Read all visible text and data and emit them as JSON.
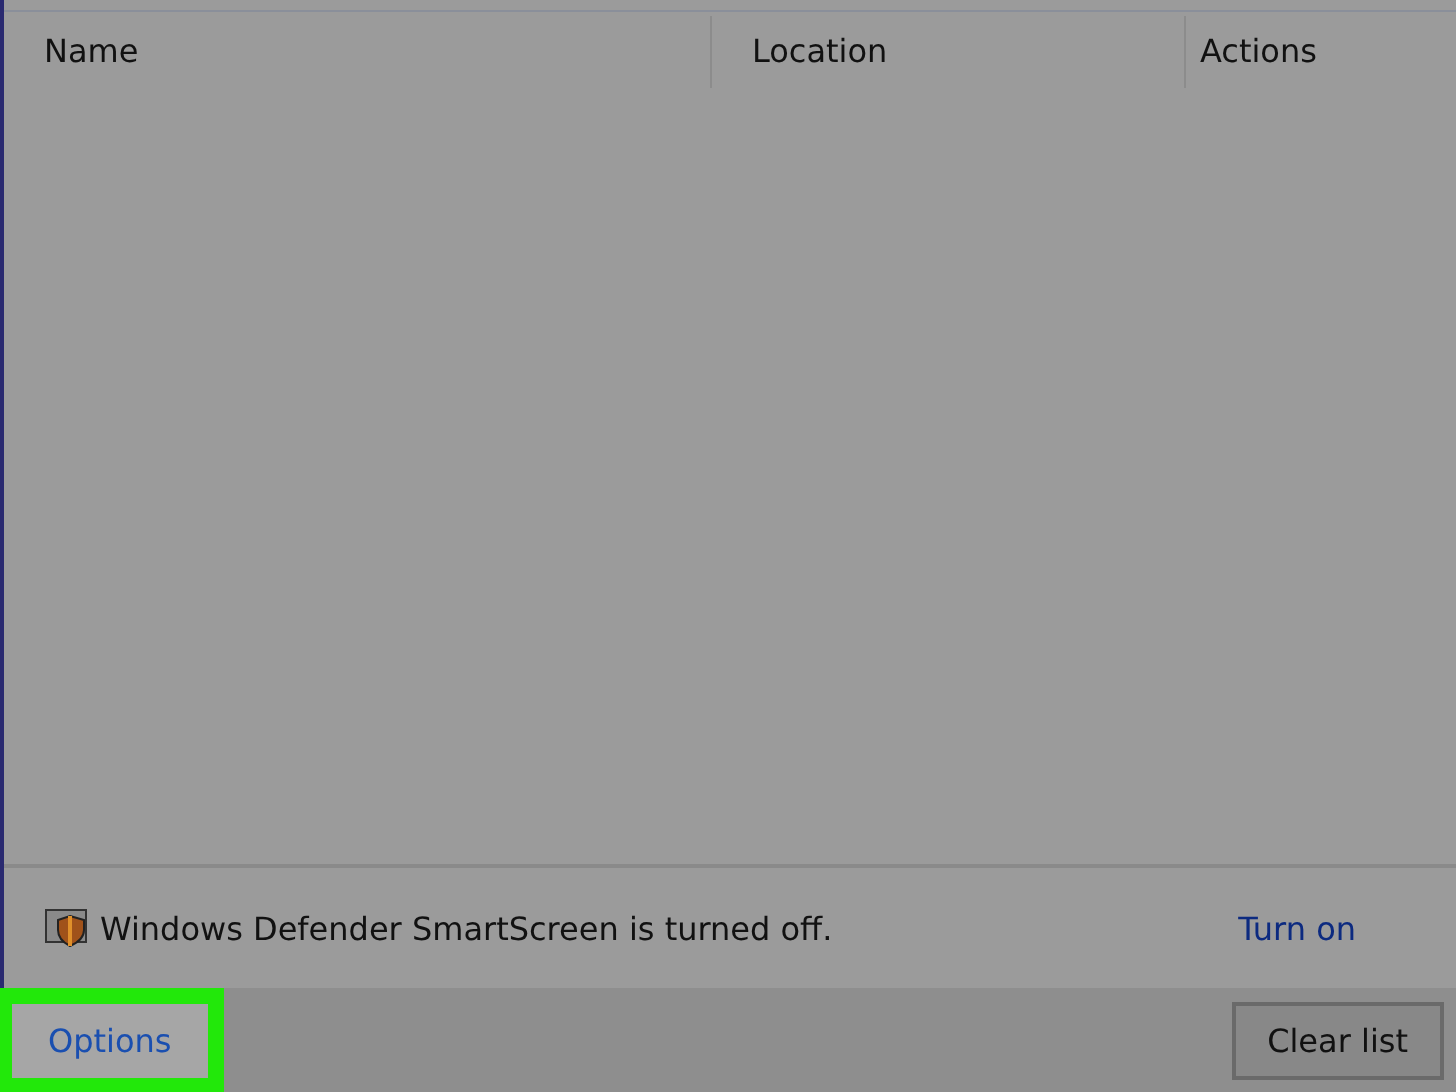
{
  "table": {
    "columns": [
      "Name",
      "Location",
      "Actions"
    ]
  },
  "smartscreen": {
    "message": "Windows Defender SmartScreen is turned off.",
    "link": "Turn on"
  },
  "footer": {
    "buttons": [
      {
        "label": "Options",
        "kind": "link",
        "highlighted": true
      },
      {
        "label": "Clear list",
        "kind": "button",
        "highlighted": false
      }
    ]
  }
}
